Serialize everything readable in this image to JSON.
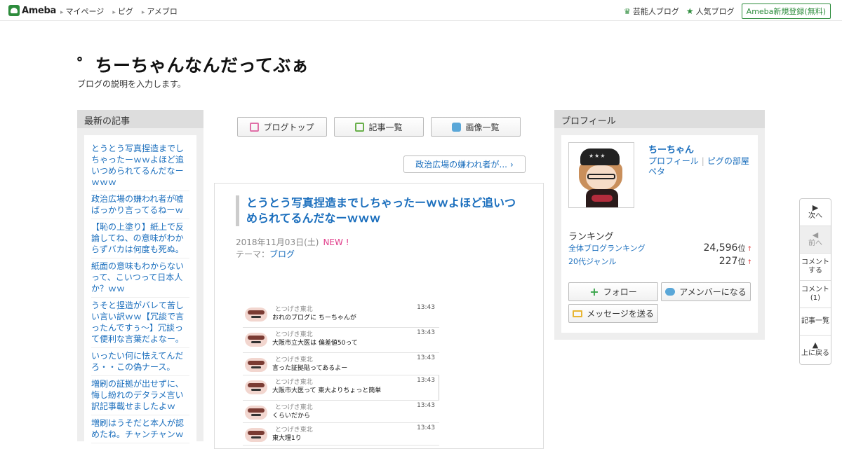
{
  "topbar": {
    "logo_text": "Ameba",
    "nav": [
      "マイページ",
      "ピグ",
      "アメブロ"
    ],
    "celebrity_blog": "芸能人ブログ",
    "popular_blog": "人気ブログ",
    "signup": "Ameba新規登録(無料)"
  },
  "blog": {
    "title": "゜ちーちゃんなんだってぶぁ",
    "description": "ブログの説明を入力します。"
  },
  "sidebar": {
    "heading": "最新の記事",
    "items": [
      "とうとう写真捏造までしちゃったーｗｗよほど追いつめられてるんだなーｗｗｗ",
      "政治広場の嫌われ者が嘘ばっかり言ってるねーｗ",
      "【恥の上塗り】紙上で反論してね、の意味がわからずバカは何度も死ぬ。",
      "紙面の意味もわからないって、こいつって日本人か？ｗｗ",
      "うそと捏造がバレて苦しい言い訳ｗｗ【冗談で言ったんですぅ～】冗談って便利な言葉だよなー。",
      "いったい何に怯えてんだろ・・この偽ナース。",
      "増刷の証拠が出せずに、悔し紛れのデタラメ言い訳記事載せましたよｗ",
      "増刷はうそだと本人が認めたね。チャンチャンｗ"
    ]
  },
  "tabs": {
    "blog_top": "ブログトップ",
    "entry_list": "記事一覧",
    "image_list": "画像一覧"
  },
  "prev_entry": "政治広場の嫌われ者が...",
  "article": {
    "title": "とうとう写真捏造までしちゃったーｗｗよほど追いつめられてるんだなーｗｗｗ",
    "date": "2018年11月03日(土)",
    "new_badge": "NEW !",
    "theme_label": "テーマ：",
    "theme_value": "ブログ",
    "chat": [
      {
        "name": "とつげき東北",
        "time": "13:43",
        "msg": "おれのブログに ちーちゃんが"
      },
      {
        "name": "とつげき東北",
        "time": "13:43",
        "msg": "大阪市立大医は 偏差値50って"
      },
      {
        "name": "とつげき東北",
        "time": "13:43",
        "msg": "言った証拠貼ってあるよー"
      },
      {
        "name": "とつげき東北",
        "time": "13:43",
        "msg": "大阪市大医って 東大よりちょっと簡単"
      },
      {
        "name": "とつげき東北",
        "time": "13:43",
        "msg": "くらいだから"
      },
      {
        "name": "とつげき東北",
        "time": "13:43",
        "msg": "東大理1り"
      }
    ]
  },
  "profile": {
    "heading": "プロフィール",
    "name": "ちーちゃん",
    "link_profile": "プロフィール",
    "link_pig_room": "ピグの部屋",
    "link_peta": "ペタ",
    "ranking_heading": "ランキング",
    "rankings": [
      {
        "label": "全体ブログランキング",
        "value": "24,596",
        "unit": "位",
        "trend": "↑"
      },
      {
        "label": "20代ジャンル",
        "value": "227",
        "unit": "位",
        "trend": "↑"
      }
    ],
    "follow": "フォロー",
    "amember": "アメンバーになる",
    "message": "メッセージを送る"
  },
  "sidenav": {
    "next": "次へ",
    "prev": "前へ",
    "comment": "コメントする",
    "comment_count": "コメント(1)",
    "entry_list": "記事一覧",
    "back_to_top": "上に戻る"
  }
}
